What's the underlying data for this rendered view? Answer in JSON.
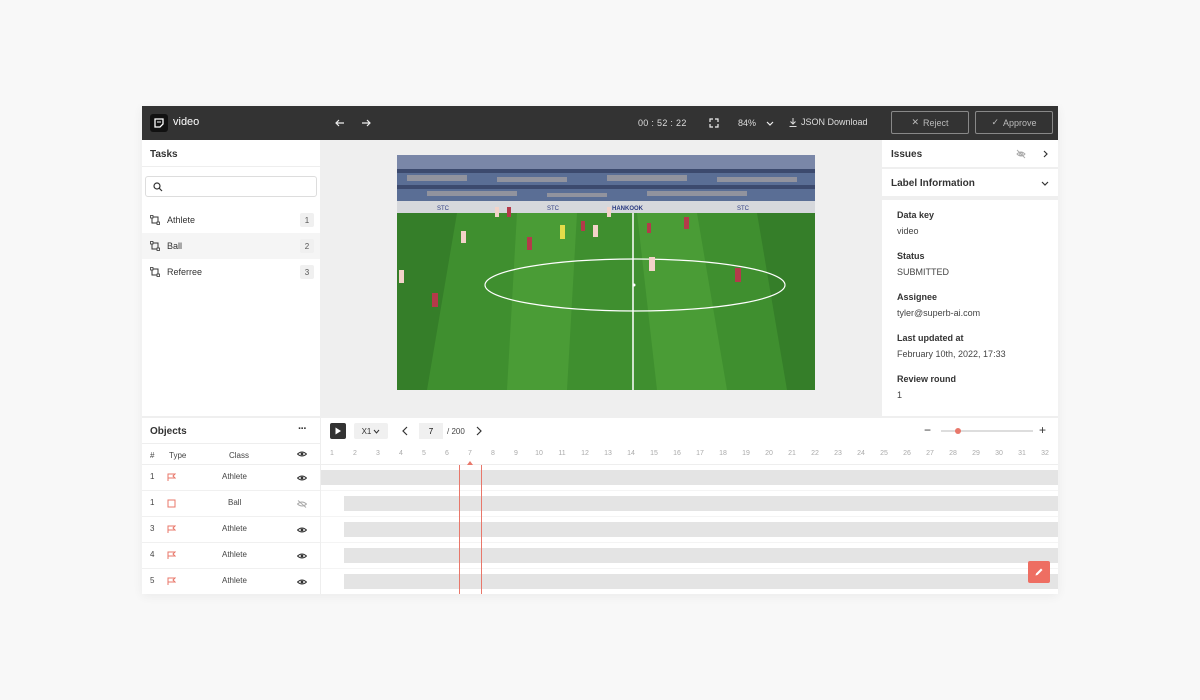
{
  "header": {
    "title": "video",
    "time": "00 : 52 : 22",
    "zoom": "84%",
    "json_download": "JSON Download",
    "reject": "Reject",
    "approve": "Approve"
  },
  "tasks": {
    "title": "Tasks",
    "search_placeholder": "",
    "items": [
      {
        "label": "Athlete",
        "count": "1"
      },
      {
        "label": "Ball",
        "count": "2"
      },
      {
        "label": "Referree",
        "count": "3"
      }
    ]
  },
  "right": {
    "issues": "Issues",
    "label_information": "Label Information",
    "fields": [
      {
        "key": "Data key",
        "value": "video"
      },
      {
        "key": "Status",
        "value": "SUBMITTED"
      },
      {
        "key": "Assignee",
        "value": "tyler@superb-ai.com"
      },
      {
        "key": "Last updated at",
        "value": "February 10th, 2022, 17:33"
      },
      {
        "key": "Review round",
        "value": "1"
      },
      {
        "key": "Last review action",
        "value": ""
      }
    ]
  },
  "objects": {
    "title": "Objects",
    "columns": {
      "num": "#",
      "type": "Type",
      "class": "Class"
    },
    "rows": [
      {
        "num": "1",
        "class": "Athlete",
        "visible": true
      },
      {
        "num": "1",
        "class": "Ball",
        "visible": false
      },
      {
        "num": "3",
        "class": "Athlete",
        "visible": true
      },
      {
        "num": "4",
        "class": "Athlete",
        "visible": true
      },
      {
        "num": "5",
        "class": "Athlete",
        "visible": true
      }
    ]
  },
  "timeline": {
    "speed": "X1",
    "frame": "7",
    "total": "/ 200",
    "ticks": [
      "1",
      "2",
      "3",
      "4",
      "5",
      "6",
      "7",
      "8",
      "9",
      "10",
      "11",
      "12",
      "13",
      "14",
      "15",
      "16",
      "17",
      "18",
      "19",
      "20",
      "21",
      "22",
      "23",
      "24",
      "25",
      "26",
      "27",
      "28",
      "29",
      "30",
      "31",
      "32"
    ]
  },
  "colors": {
    "accent": "#ee6e62",
    "topbar": "#333333"
  }
}
